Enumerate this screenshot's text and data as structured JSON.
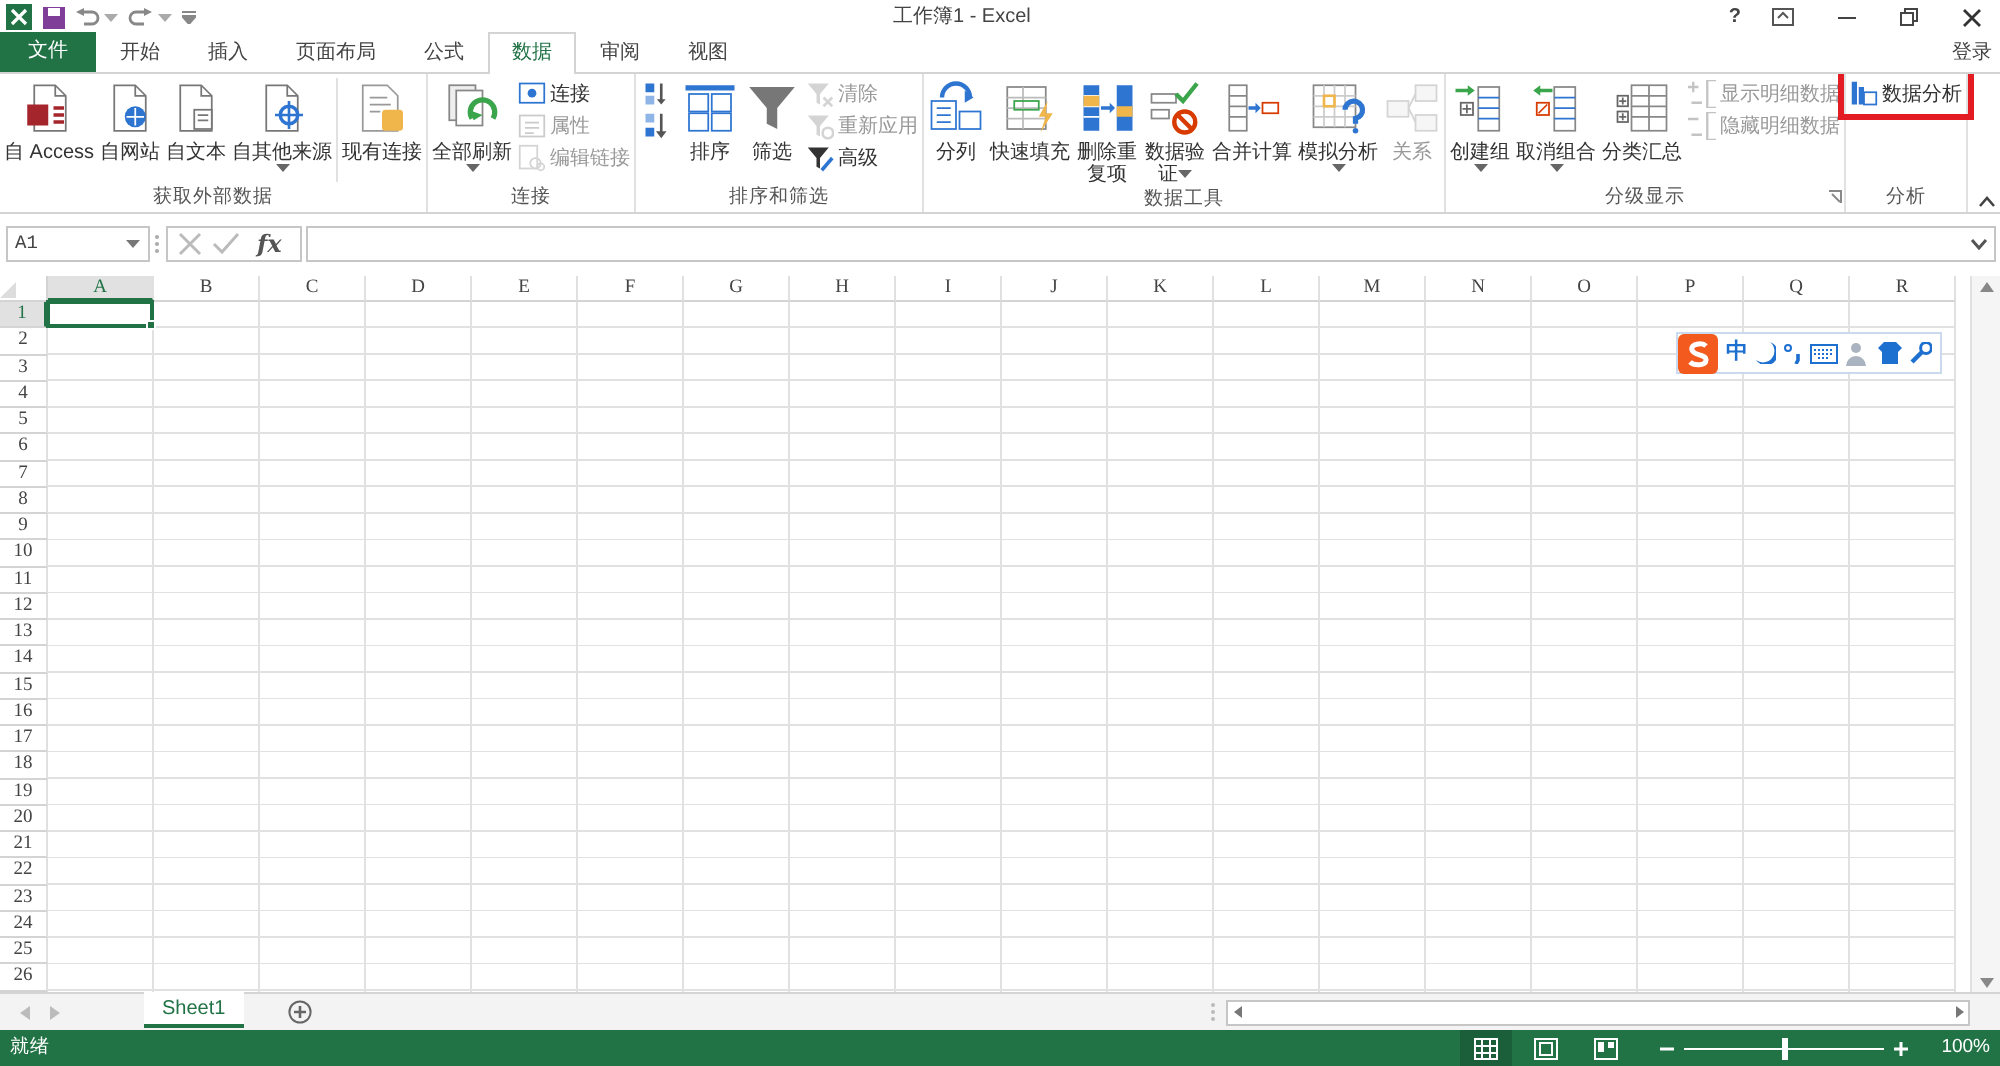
{
  "window": {
    "title": "工作簿1 - Excel",
    "help": "?",
    "sign_in": "登录"
  },
  "tabs": [
    {
      "label": "文件",
      "kind": "file",
      "selected": false
    },
    {
      "label": "开始",
      "kind": "tab",
      "selected": false
    },
    {
      "label": "插入",
      "kind": "tab",
      "selected": false
    },
    {
      "label": "页面布局",
      "kind": "tab",
      "selected": false
    },
    {
      "label": "公式",
      "kind": "tab",
      "selected": false
    },
    {
      "label": "数据",
      "kind": "tab",
      "selected": true
    },
    {
      "label": "审阅",
      "kind": "tab",
      "selected": false
    },
    {
      "label": "视图",
      "kind": "tab",
      "selected": false
    }
  ],
  "ribbon_groups": [
    {
      "label": "获取外部数据",
      "commands": [
        {
          "kind": "large",
          "label": "自 Access",
          "disabled": false
        },
        {
          "kind": "large",
          "label": "自网站",
          "disabled": false
        },
        {
          "kind": "large",
          "label": "自文本",
          "disabled": false
        },
        {
          "kind": "large",
          "label": "自其他来源",
          "disabled": false,
          "dropdown": true
        },
        {
          "kind": "separator"
        },
        {
          "kind": "large",
          "label": "现有连接",
          "disabled": false
        }
      ]
    },
    {
      "label": "连接",
      "commands": [
        {
          "kind": "large",
          "label": "全部刷新",
          "disabled": false,
          "dropdown": true
        },
        {
          "kind": "small",
          "label": "连接",
          "disabled": false
        },
        {
          "kind": "small",
          "label": "属性",
          "disabled": true
        },
        {
          "kind": "small",
          "label": "编辑链接",
          "disabled": true
        }
      ]
    },
    {
      "label": "排序和筛选",
      "commands": [
        {
          "kind": "small",
          "disabled": false
        },
        {
          "kind": "small",
          "disabled": false
        },
        {
          "kind": "large",
          "label": "排序",
          "disabled": false
        },
        {
          "kind": "large",
          "label": "筛选",
          "disabled": false
        },
        {
          "kind": "small",
          "label": "清除",
          "disabled": true
        },
        {
          "kind": "small",
          "label": "重新应用",
          "disabled": true
        },
        {
          "kind": "small",
          "label": "高级",
          "disabled": false
        }
      ]
    },
    {
      "label": "数据工具",
      "commands": [
        {
          "kind": "large",
          "label": "分列",
          "disabled": false
        },
        {
          "kind": "large",
          "label": "快速填充",
          "disabled": false
        },
        {
          "kind": "large",
          "label": "删除重复项",
          "two_line": true,
          "disabled": false
        },
        {
          "kind": "large",
          "label": "数据验证",
          "two_line": true,
          "disabled": false,
          "dropdown": true
        },
        {
          "kind": "large",
          "label": "合并计算",
          "disabled": false
        },
        {
          "kind": "large",
          "label": "模拟分析",
          "disabled": false,
          "dropdown": true
        },
        {
          "kind": "large",
          "label": "关系",
          "disabled": true
        }
      ]
    },
    {
      "label": "分级显示",
      "launcher": true,
      "commands": [
        {
          "kind": "large",
          "label": "创建组",
          "disabled": false,
          "dropdown": true
        },
        {
          "kind": "large",
          "label": "取消组合",
          "disabled": false,
          "dropdown": true
        },
        {
          "kind": "large",
          "label": "分类汇总",
          "disabled": false
        },
        {
          "kind": "small",
          "label": "显示明细数据",
          "disabled": true
        },
        {
          "kind": "small",
          "label": "隐藏明细数据",
          "disabled": true
        }
      ]
    },
    {
      "label": "分析",
      "commands": [
        {
          "kind": "small",
          "label": "数据分析",
          "disabled": false,
          "highlighted": true
        }
      ]
    }
  ],
  "formula_bar": {
    "name_box": "A1",
    "insert_function": "fx"
  },
  "columns": [
    {
      "label": "A",
      "selected": true
    },
    {
      "label": "B",
      "selected": false
    },
    {
      "label": "C",
      "selected": false
    },
    {
      "label": "D",
      "selected": false
    },
    {
      "label": "E",
      "selected": false
    },
    {
      "label": "F",
      "selected": false
    },
    {
      "label": "G",
      "selected": false
    },
    {
      "label": "H",
      "selected": false
    },
    {
      "label": "I",
      "selected": false
    },
    {
      "label": "J",
      "selected": false
    },
    {
      "label": "K",
      "selected": false
    },
    {
      "label": "L",
      "selected": false
    },
    {
      "label": "M",
      "selected": false
    },
    {
      "label": "N",
      "selected": false
    },
    {
      "label": "O",
      "selected": false
    },
    {
      "label": "P",
      "selected": false
    },
    {
      "label": "Q",
      "selected": false
    },
    {
      "label": "R",
      "selected": false
    }
  ],
  "rows": [
    {
      "label": "1",
      "selected": true
    },
    {
      "label": "2",
      "selected": false
    },
    {
      "label": "3",
      "selected": false
    },
    {
      "label": "4",
      "selected": false
    },
    {
      "label": "5",
      "selected": false
    },
    {
      "label": "6",
      "selected": false
    },
    {
      "label": "7",
      "selected": false
    },
    {
      "label": "8",
      "selected": false
    },
    {
      "label": "9",
      "selected": false
    },
    {
      "label": "10",
      "selected": false
    },
    {
      "label": "11",
      "selected": false
    },
    {
      "label": "12",
      "selected": false
    },
    {
      "label": "13",
      "selected": false
    },
    {
      "label": "14",
      "selected": false
    },
    {
      "label": "15",
      "selected": false
    },
    {
      "label": "16",
      "selected": false
    },
    {
      "label": "17",
      "selected": false
    },
    {
      "label": "18",
      "selected": false
    },
    {
      "label": "19",
      "selected": false
    },
    {
      "label": "20",
      "selected": false
    },
    {
      "label": "21",
      "selected": false
    },
    {
      "label": "22",
      "selected": false
    },
    {
      "label": "23",
      "selected": false
    },
    {
      "label": "24",
      "selected": false
    },
    {
      "label": "25",
      "selected": false
    },
    {
      "label": "26",
      "selected": false
    }
  ],
  "ime_toolbar": {
    "mode": "中"
  },
  "sheets": [
    {
      "label": "Sheet1",
      "selected": true
    }
  ],
  "status_bar": {
    "status": "就绪",
    "views": [
      {
        "selected": true
      },
      {
        "selected": false
      },
      {
        "selected": false
      }
    ],
    "zoom": {
      "level": 0.5,
      "reading": "100%"
    }
  }
}
